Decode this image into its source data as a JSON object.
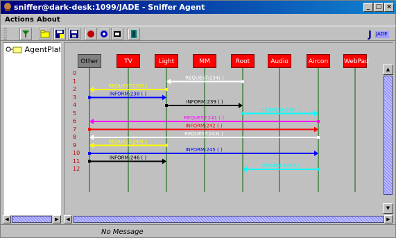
{
  "window": {
    "title": "sniffer@dark-desk:1099/JADE - Sniffer Agent",
    "buttons": {
      "minimize": "_",
      "maximize": "□",
      "close": "×"
    }
  },
  "menu": {
    "items": [
      "Actions",
      "About"
    ]
  },
  "toolbar": {
    "icons": [
      "filter-icon",
      "open-folder-icon",
      "save-as-icon",
      "save-icon",
      "record-icon",
      "pause-icon",
      "stop-icon",
      "exit-icon"
    ],
    "right_logo": "JADE"
  },
  "tree": {
    "root_label": "AgentPlatf"
  },
  "agents": [
    "Other",
    "TV",
    "Light",
    "MM",
    "Root",
    "Audio",
    "Aircon",
    "WebPad"
  ],
  "rows": [
    "0",
    "1",
    "2",
    "3",
    "4",
    "5",
    "6",
    "7",
    "8",
    "9",
    "10",
    "11",
    "12"
  ],
  "messages": [
    {
      "row": 1,
      "from": 4,
      "to": 2,
      "label": "REQUEST:234(   )",
      "color": "#ffffff"
    },
    {
      "row": 2,
      "from": 2,
      "to": 0,
      "label": "REQUEST:237(   )",
      "color": "#ffff00"
    },
    {
      "row": 3,
      "from": 0,
      "to": 2,
      "label": "INFORM:238 (     )",
      "color": "#0000ff"
    },
    {
      "row": 4,
      "from": 2,
      "to": 4,
      "label": "INFORM:239 (     )",
      "color": "#000000"
    },
    {
      "row": 5,
      "from": 4,
      "to": 6,
      "label": "REQUEST:240(   )",
      "color": "#00ffff"
    },
    {
      "row": 6,
      "from": 6,
      "to": 0,
      "label": "REQUEST:241 (     )",
      "color": "#ff00ff"
    },
    {
      "row": 7,
      "from": 0,
      "to": 6,
      "label": "INFORM:242 (     )",
      "color": "#ff0000"
    },
    {
      "row": 8,
      "from": 6,
      "to": 0,
      "label": "REQUEST:243(   )",
      "color": "#ffffff"
    },
    {
      "row": 9,
      "from": 2,
      "to": 0,
      "label": "REQUEST:244(   )",
      "color": "#ffff00"
    },
    {
      "row": 10,
      "from": 0,
      "to": 6,
      "label": "INFORM:245 (     )",
      "color": "#0000ff"
    },
    {
      "row": 11,
      "from": 0,
      "to": 2,
      "label": "INFORM:246 (     )",
      "color": "#000000"
    },
    {
      "row": 12,
      "from": 6,
      "to": 4,
      "label": "INFORM:247 (     )",
      "color": "#00ffff"
    }
  ],
  "status": {
    "text": "No Message"
  }
}
